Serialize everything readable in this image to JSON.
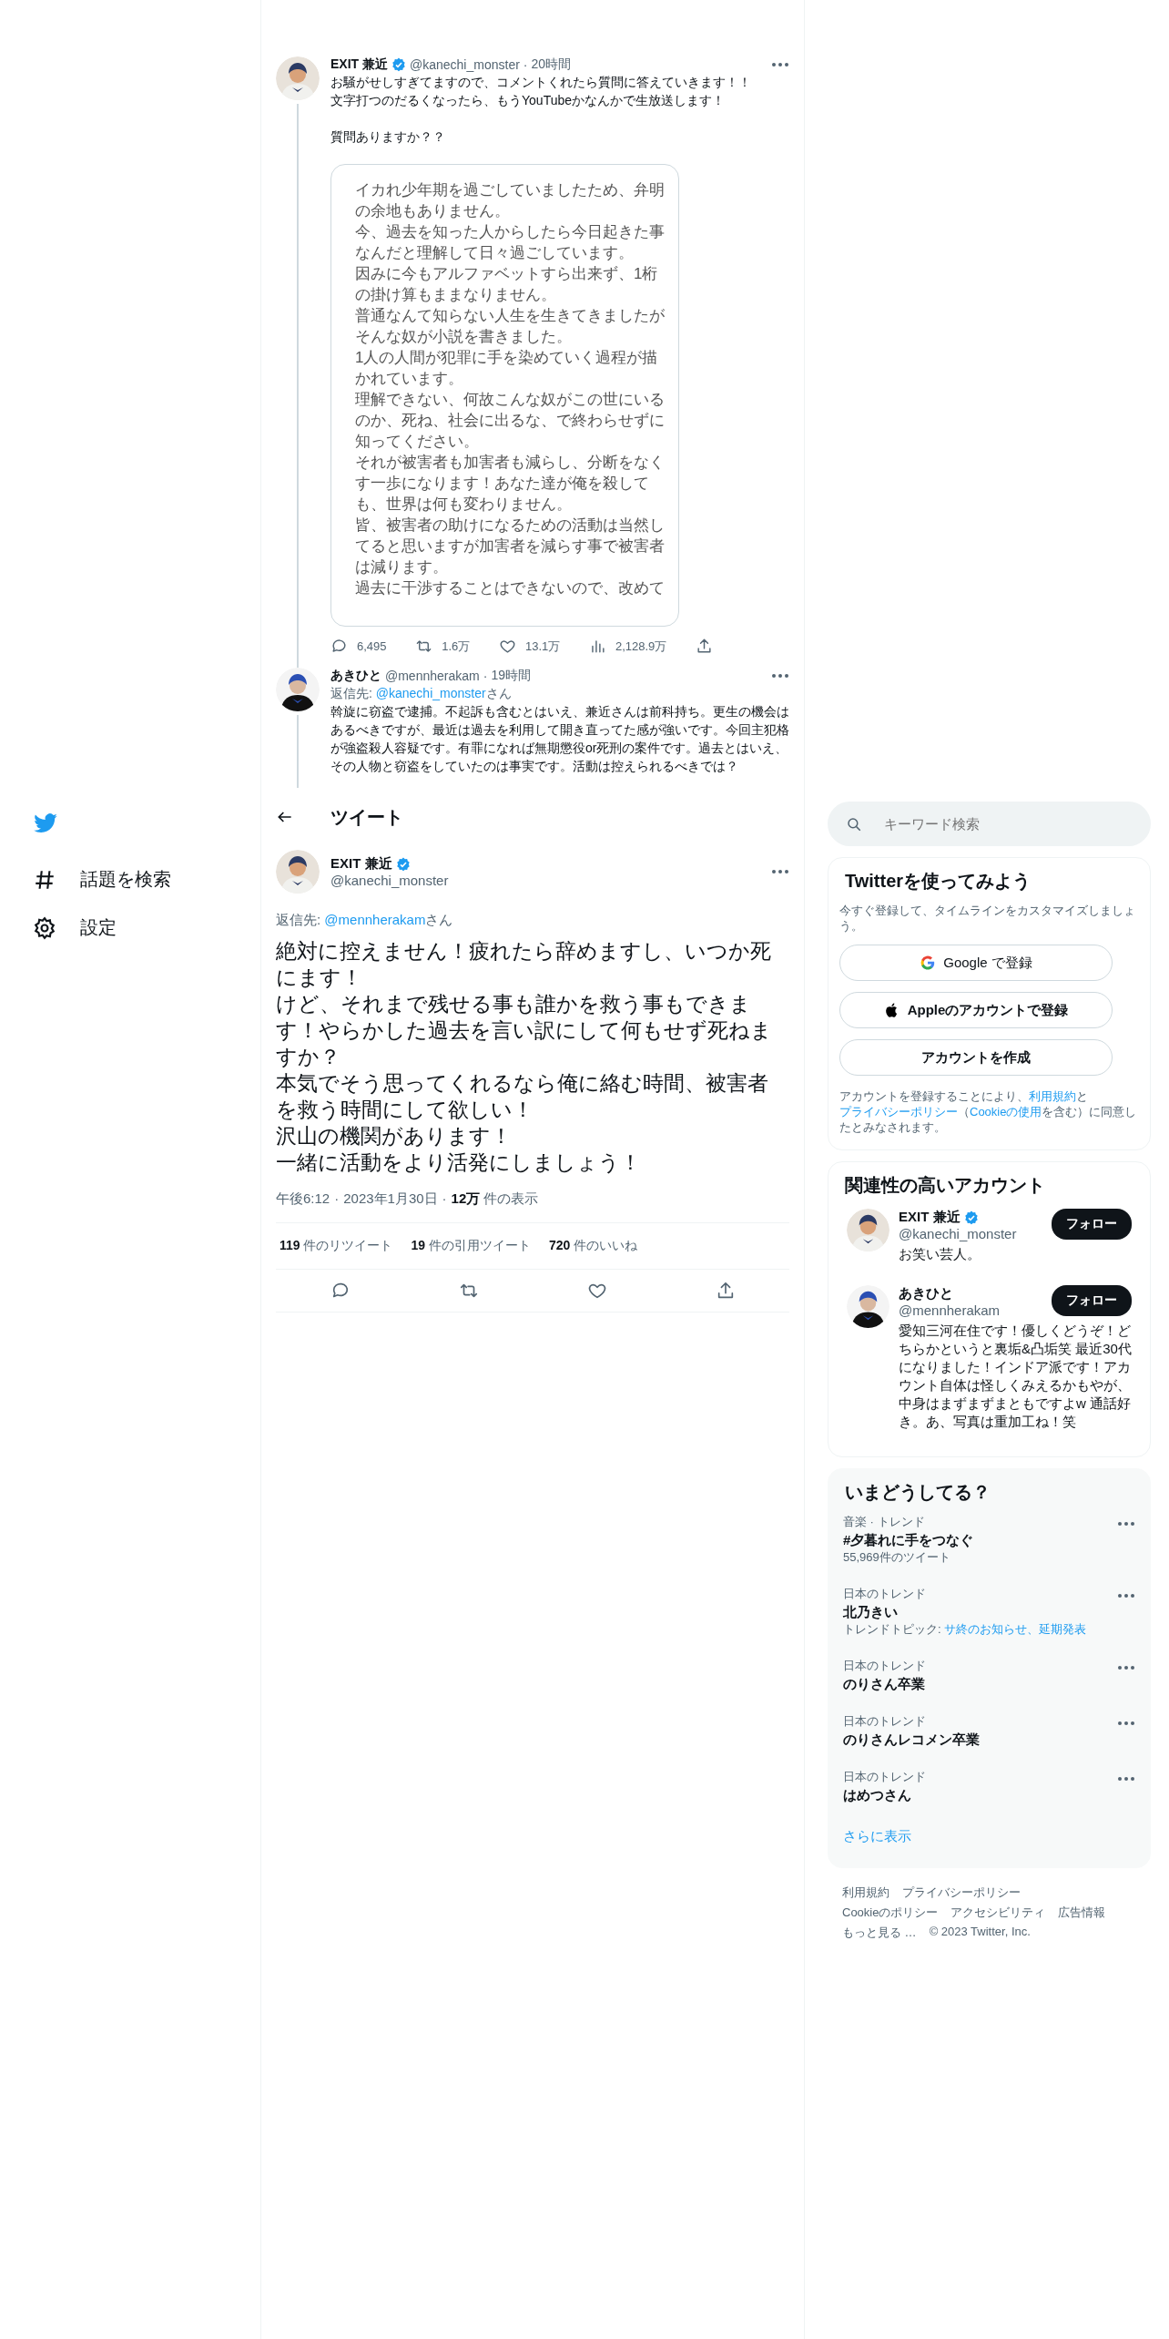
{
  "sidebar": {
    "items": [
      {
        "kind": "explore",
        "label": "話題を検索"
      },
      {
        "kind": "settings",
        "label": "設定"
      }
    ]
  },
  "thread": [
    {
      "name": "EXIT 兼近",
      "verified": true,
      "handle": "@kanechi_monster",
      "separator": "·",
      "time": "20時間",
      "paragraphs": [
        [
          "お騒がせしすぎてますので、コメントくれたら質問に答えていきます！！",
          "文字打つのだるくなったら、もうYouTubeかなんかで生放送します！"
        ],
        [
          "質問ありますか？？"
        ]
      ],
      "image_lines": [
        "イカれ少年期を過ごしていましたため、弁明",
        "の余地もありません。",
        "今、過去を知った人からしたら今日起きた事",
        "なんだと理解して日々過ごしています。",
        "因みに今もアルファベットすら出来ず、1桁",
        "の掛け算もままなりません。",
        "普通なんて知らない人生を生きてきましたが",
        "そんな奴が小説を書きました。",
        "1人の人間が犯罪に手を染めていく過程が描",
        "かれています。",
        "理解できない、何故こんな奴がこの世にいる",
        "のか、死ね、社会に出るな、で終わらせずに",
        "知ってください。",
        "それが被害者も加害者も減らし、分断をなく",
        "す一歩になります！あなた達が俺を殺して",
        "も、世界は何も変わりません。",
        "皆、被害者の助けになるための活動は当然し",
        "てると思いますが加害者を減らす事で被害者",
        "は減ります。",
        "過去に干渉することはできないので、改めて"
      ],
      "stats": [
        {
          "kind": "reply",
          "count": "6,495"
        },
        {
          "kind": "retweet",
          "count": "1.6万"
        },
        {
          "kind": "like",
          "count": "13.1万"
        },
        {
          "kind": "views",
          "count": "2,128.9万"
        },
        {
          "kind": "share"
        }
      ]
    },
    {
      "name": "あきひと",
      "verified": false,
      "handle": "@mennherakam",
      "separator": "·",
      "time": "19時間",
      "reply_prefix": "返信先: ",
      "reply_handle": "@kanechi_monster",
      "reply_suffix": "さん",
      "paragraphs": [
        [
          "斡旋に窃盗で逮捕。不起訴も含むとはいえ、兼近さんは前科持ち。更生の機会はあるべきですが、最近は過去を利用して開き直ってた感が強いです。今回主犯格が強盗殺人容疑です。有罪になれば無期懲役or死刑の案件です。過去とはいえ、その人物と窃盗をしていたのは事実です。活動は控えられるべきでは？"
        ]
      ]
    }
  ],
  "header": {
    "title": "ツイート"
  },
  "main_tweet": {
    "name": "EXIT 兼近",
    "verified": true,
    "handle": "@kanechi_monster",
    "reply_prefix": "返信先: ",
    "reply_handle": "@mennherakam",
    "reply_suffix": "さん",
    "lines": [
      "絶対に控えません！疲れたら辞めますし、いつか死にます！",
      "けど、それまで残せる事も誰かを救う事もできます！やらかした過去を言い訳にして何もせず死ねますか？",
      "本気でそう思ってくれるなら俺に絡む時間、被害者を救う時間にして欲しい！",
      "沢山の機関があります！",
      "一緒に活動をより活発にしましょう！"
    ],
    "separator": "·",
    "time": "午後6:12",
    "date": "2023年1月30日",
    "views": "12万",
    "views_label": "件の表示",
    "counts": [
      {
        "count": "119",
        "label": "件のリツイート"
      },
      {
        "count": "19",
        "label": "件の引用ツイート"
      },
      {
        "count": "720",
        "label": "件のいいね"
      }
    ],
    "actions": [
      {
        "kind": "reply"
      },
      {
        "kind": "retweet"
      },
      {
        "kind": "like"
      },
      {
        "kind": "share"
      }
    ]
  },
  "search": {
    "placeholder": "キーワード検索"
  },
  "signup": {
    "title": "Twitterを使ってみよう",
    "subtitle": "今すぐ登録して、タイムラインをカスタマイズしましょう。",
    "buttons": [
      {
        "kind": "google",
        "label": "Google で登録"
      },
      {
        "kind": "apple",
        "label": "Appleのアカウントで登録"
      },
      {
        "kind": "plain",
        "label": "アカウントを作成"
      }
    ],
    "legal": [
      {
        "text": "アカウントを登録することにより、",
        "link": false
      },
      {
        "text": "利用規約",
        "link": true
      },
      {
        "text": "と",
        "link": false
      },
      {
        "text": "プライバシーポリシー",
        "link": true
      },
      {
        "text": "（",
        "link": false
      },
      {
        "text": "Cookieの使用",
        "link": true
      },
      {
        "text": "を含む）に同意したとみなされます。",
        "link": false
      }
    ]
  },
  "related": {
    "title": "関連性の高いアカウント",
    "accounts": [
      {
        "name": "EXIT 兼近",
        "verified": true,
        "handle": "@kanechi_monster",
        "button": "フォロー",
        "bio": "お笑い芸人。"
      },
      {
        "name": "あきひと",
        "verified": false,
        "handle": "@mennherakam",
        "button": "フォロー",
        "bio": "愛知三河在住です！優しくどうぞ！どちらかというと裏垢&凸垢笑 最近30代になりました！インドア派です！アカウント自体は怪しくみえるかもやが、中身はまずまずまともですよw 通話好き。あ、写真は重加工ね！笑"
      }
    ]
  },
  "trends": {
    "title": "いまどうしてる？",
    "items": [
      {
        "context": "音楽 · トレンド",
        "title": "#夕暮れに手をつなぐ",
        "detail": "55,969件のツイート"
      },
      {
        "context": "日本のトレンド",
        "title": "北乃きい",
        "topic_prefix": "トレンドトピック: ",
        "topic": "サ終のお知らせ、延期発表"
      },
      {
        "context": "日本のトレンド",
        "title": "のりさん卒業"
      },
      {
        "context": "日本のトレンド",
        "title": "のりさんレコメン卒業"
      },
      {
        "context": "日本のトレンド",
        "title": "はめつさん"
      }
    ],
    "more": "さらに表示"
  },
  "footer": {
    "links": [
      "利用規約",
      "プライバシーポリシー",
      "Cookieのポリシー",
      "アクセシビリティ",
      "広告情報",
      "もっと見る …"
    ],
    "copyright": "© 2023 Twitter, Inc."
  }
}
